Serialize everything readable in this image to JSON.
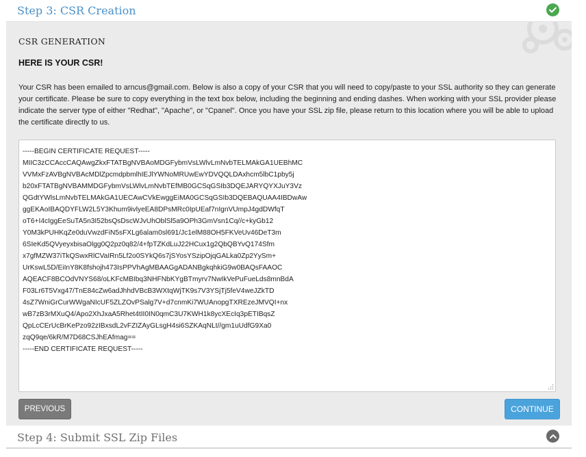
{
  "steps": {
    "step3": {
      "title": "Step 3: CSR Creation",
      "status_icon": "check-circle-icon",
      "color": "#4a90c8"
    },
    "step4": {
      "title": "Step 4: Submit SSL Zip Files",
      "status_icon": "chevron-up-circle-icon"
    }
  },
  "panel": {
    "heading": "CSR GENERATION",
    "subheading": "HERE IS YOUR CSR!",
    "instructions": "Your CSR has been emailed to arncus@gmail.com. Below is also a copy of your CSR that you will need to copy/paste to your SSL authority so they can generate your certificate. Please be sure to copy everything in the text box below, including the beginning and ending dashes. When working with your SSL provider please indicate the server type of either \"Redhat\", \"Apache\", or \"Cpanel\". Once you have your SSL zip file, please return to this location where you will be able to upload the certificate directly to us.",
    "csr_text": "-----BEGIN CERTIFICATE REQUEST-----\nMIIC3zCCAccCAQAwgZkxFTATBgNVBAoMDGFybmVsLWlvLmNvbTELMAkGA1UEBhMC\nVVMxFzAVBgNVBAcMDlZpcmdpbmlhIEJlYWNoMRUwEwYDVQQLDAxhcm5lbC1pby5j\nb20xFTATBgNVBAMMDGFybmVsLWlvLmNvbTEfMB0GCSqGSIb3DQEJARYQYXJuY3Vz\nQGdtYWlsLmNvbTELMAkGA1UECAwCVkEwggEiMA0GCSqGSIb3DQEBAQUAA4IBDwAw\nggEKAoIBAQDYFLW2L5Y3Khum9ivlyeEA8DPsMRc0IpUEaf7nIgnVUmpJ4gdDWfqT\noT6+I4cIggEeSuTA5n3I52bsQsDscWJvUhOblSl5a9OPh3GmVsn1Cq//c+kyGb12\nY0M3kPUHKqZe0duVwzdFiN5sFXLg6alam0sl691/Jc1elM88OH5FKVeUv46DeT3m\n6SIeKd5QVyeyxbisaOlgg0Q2pz0q82/4+fpTZKdLuJ22HCux1g2QbQBYvQ174Sfm\nx7gfMZW37iTkQSwxRlCVaIRn5Lf2o0SYkQ6s7jSYosYSzipOjqGALka0Zp2YySm+\nUrKswL5D/EiInY8K8fshojh473IsPPVhAgMBAAGgADANBgkqhkiG9w0BAQsFAAOC\nAQEACF8BCOdVNYS68/oLKFcMBIbq3NHFNbKYgBTmyrv7NwIkVePuFueLds8mnBdA\nF03Lr6T5Vxg47/TnE84cZw6adJhhdVBcB3WXtqWjTK9s7V3YSjTj5feV4weJZkTD\n4sZ7WniGrCurWWgaNIcUF5ZLZOvPSalg7V+d7cnmKi7WUAnopgTXREzeJMVQI+nx\nwB7zB3rMXuQ4/Apo2XhJxaA5Rhet4tII0IN0qmC3U7KWH1k8ycXEcIq3pETIBqsZ\nQpLcCErUcBrKePzo92zIBxsdL2vFZIZAyGLsgH4si6SZKAqNLt//gm1uUdfG9Xa0\nzqQ9qe/6kR/M7D68CSJhEAfmag==\n-----END CERTIFICATE REQUEST-----"
  },
  "buttons": {
    "previous": "PREVIOUS",
    "continue": "CONTINUE"
  },
  "colors": {
    "accent": "#4ba3dc",
    "success": "#4aa84f",
    "panel_bg": "#ebebeb"
  }
}
